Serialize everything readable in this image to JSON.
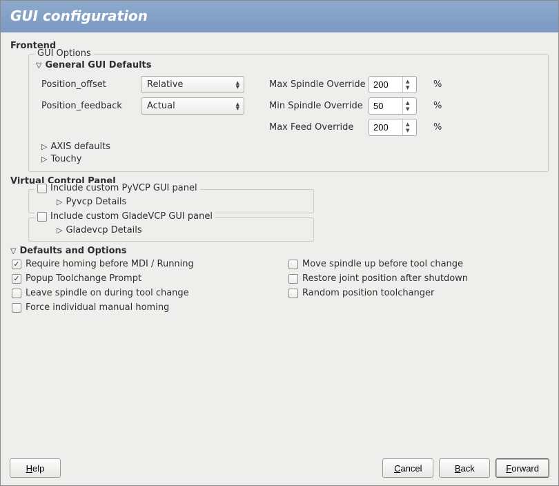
{
  "title": "GUI configuration",
  "frontend_label": "Frontend",
  "gui_options_label": "GUI Options",
  "general_defaults_label": "General GUI Defaults",
  "position_offset_label": "Position_offset",
  "position_offset_value": "Relative",
  "position_feedback_label": "Position_feedback",
  "position_feedback_value": "Actual",
  "max_spindle_label": "Max Spindle Override",
  "max_spindle_value": "200",
  "min_spindle_label": "Min Spindle Override",
  "min_spindle_value": "50",
  "max_feed_label": "Max Feed Override",
  "max_feed_value": "200",
  "percent": "%",
  "axis_defaults_label": "AXIS defaults",
  "touchy_label": "Touchy",
  "vcp_label": "Virtual Control Panel",
  "pyvcp_cb_label": "Include custom PyVCP GUI panel",
  "pyvcp_details_label": "Pyvcp Details",
  "gladevcp_cb_label": "Include custom GladeVCP GUI panel",
  "gladevcp_details_label": "Gladevcp Details",
  "defaults_options_label": "Defaults and Options",
  "opts": {
    "require_homing": "Require homing before MDI / Running",
    "popup_toolchange": "Popup Toolchange Prompt",
    "leave_spindle": "Leave spindle on during tool change",
    "force_homing": "Force individual manual homing",
    "move_spindle_up": "Move spindle up before tool change",
    "restore_joint": "Restore joint position after shutdown",
    "random_toolchanger": "Random position toolchanger"
  },
  "buttons": {
    "help": "elp",
    "cancel": "ancel",
    "back": "ack",
    "forward": "orward"
  }
}
